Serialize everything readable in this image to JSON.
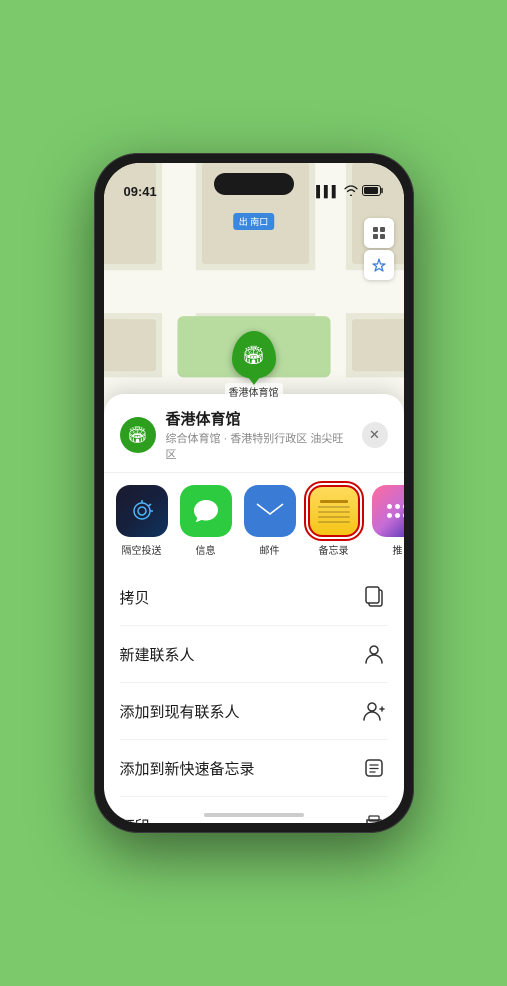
{
  "status_bar": {
    "time": "09:41",
    "signal_icon": "▌▌▌",
    "wifi_icon": "wifi",
    "battery_icon": "battery",
    "location_icon": "➤"
  },
  "map": {
    "label_nankou": "南口",
    "label_nankou_prefix": "出",
    "venue_name": "香港体育馆",
    "map_ctrl_layers": "🗺",
    "map_ctrl_location": "➤"
  },
  "sheet": {
    "venue_name": "香港体育馆",
    "venue_subtitle": "综合体育馆 · 香港特别行政区 油尖旺区",
    "close_label": "✕"
  },
  "share_items": [
    {
      "id": "airdrop",
      "label": "隔空投送",
      "type": "airdrop"
    },
    {
      "id": "messages",
      "label": "信息",
      "type": "messages"
    },
    {
      "id": "mail",
      "label": "邮件",
      "type": "mail"
    },
    {
      "id": "notes",
      "label": "备忘录",
      "type": "notes",
      "highlighted": true
    },
    {
      "id": "more",
      "label": "推",
      "type": "more"
    }
  ],
  "actions": [
    {
      "id": "copy",
      "label": "拷贝",
      "icon": "copy"
    },
    {
      "id": "new-contact",
      "label": "新建联系人",
      "icon": "person"
    },
    {
      "id": "add-existing",
      "label": "添加到现有联系人",
      "icon": "person-add"
    },
    {
      "id": "add-notes",
      "label": "添加到新快速备忘录",
      "icon": "memo"
    },
    {
      "id": "print",
      "label": "打印",
      "icon": "print"
    }
  ],
  "colors": {
    "green_bg": "#7bc96b",
    "map_road": "#f0efea",
    "map_block": "#e0dfd0",
    "pin_green": "#2d9e1e",
    "notes_yellow": "#f5c518",
    "highlight_red": "#cc0000"
  }
}
